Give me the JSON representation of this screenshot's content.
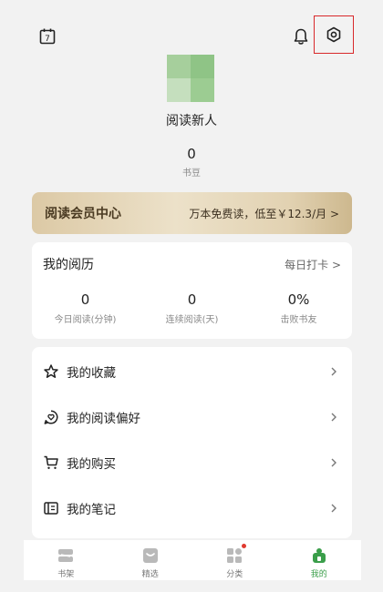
{
  "topbar": {
    "calendar_day": "7",
    "icons": [
      "calendar-icon",
      "bell-icon",
      "settings-icon"
    ]
  },
  "profile": {
    "username": "阅读新人",
    "beans_count": "0",
    "beans_label": "书豆"
  },
  "vip": {
    "title": "阅读会员中心",
    "offer": "万本免费读，低至￥12.3/月",
    "chevron": ">"
  },
  "reading_history": {
    "title": "我的阅历",
    "checkin": "每日打卡",
    "chevron": ">",
    "stats": [
      {
        "value": "0",
        "label": "今日阅读(分钟)"
      },
      {
        "value": "0",
        "label": "连续阅读(天)"
      },
      {
        "value": "0%",
        "label": "击败书友"
      }
    ]
  },
  "menu": {
    "items": [
      {
        "label": "我的收藏",
        "icon": "star-icon"
      },
      {
        "label": "我的阅读偏好",
        "icon": "heart-chat-icon"
      },
      {
        "label": "我的购买",
        "icon": "cart-icon"
      },
      {
        "label": "我的笔记",
        "icon": "notebook-icon"
      }
    ]
  },
  "tabbar": {
    "tabs": [
      {
        "label": "书架",
        "icon": "bookshelf-icon",
        "active": false
      },
      {
        "label": "精选",
        "icon": "featured-icon",
        "active": false
      },
      {
        "label": "分类",
        "icon": "category-icon",
        "active": false,
        "badge": true
      },
      {
        "label": "我的",
        "icon": "profile-icon",
        "active": true
      }
    ]
  },
  "colors": {
    "accent_green": "#3a9e4a",
    "badge_red": "#e03a2f",
    "highlight_box": "#d8282a"
  }
}
